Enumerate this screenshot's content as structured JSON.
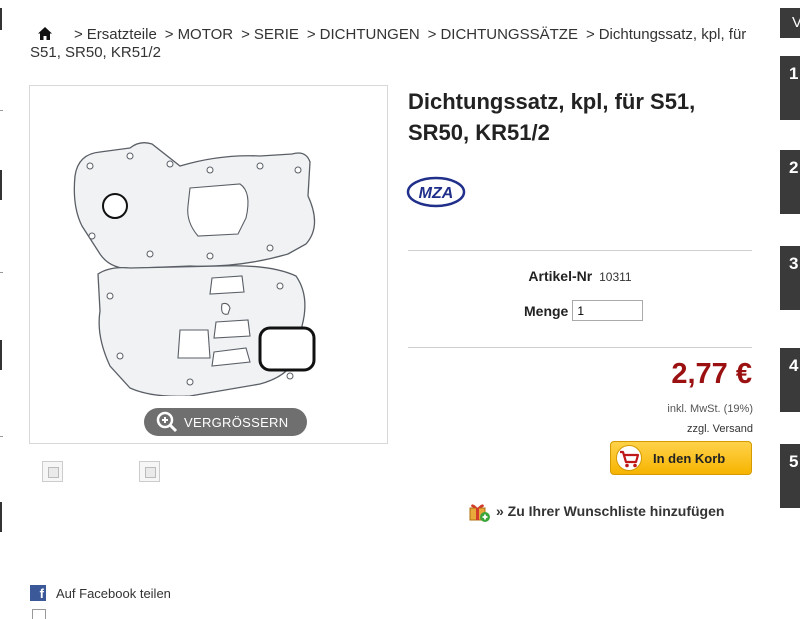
{
  "breadcrumb": {
    "items": [
      "Ersatzteile",
      "MOTOR",
      "SERIE",
      "DICHTUNGEN",
      "DICHTUNGSSÄTZE"
    ],
    "current": "Dichtungssatz, kpl, für S51, SR50, KR51/2"
  },
  "product": {
    "title": "Dichtungssatz, kpl, für S51, SR50, KR51/2",
    "brand": "MZA",
    "zoom_label": "VERGRÖSSERN",
    "article_label": "Artikel-Nr",
    "article_number": "10311",
    "quantity_label": "Menge",
    "quantity_value": "1",
    "price": "2,77 €",
    "tax_note": "inkl. MwSt. (19%)",
    "shipping_note": "zzgl. Versand",
    "cart_button": "In den Korb",
    "wishlist_link": "» Zu Ihrer Wunschliste hinzufügen",
    "facebook_share": "Auf Facebook teilen"
  },
  "sidebar": {
    "header": "V",
    "items": [
      "1",
      "2",
      "3",
      "4",
      "5"
    ]
  },
  "colors": {
    "price": "#9b1111",
    "cart_button": "#f6b400",
    "sidebar": "#3a3a3a",
    "facebook": "#3b5998"
  },
  "icons": [
    "home-icon",
    "zoom-icon",
    "brand-logo",
    "cart-icon",
    "gift-icon",
    "facebook-icon"
  ]
}
